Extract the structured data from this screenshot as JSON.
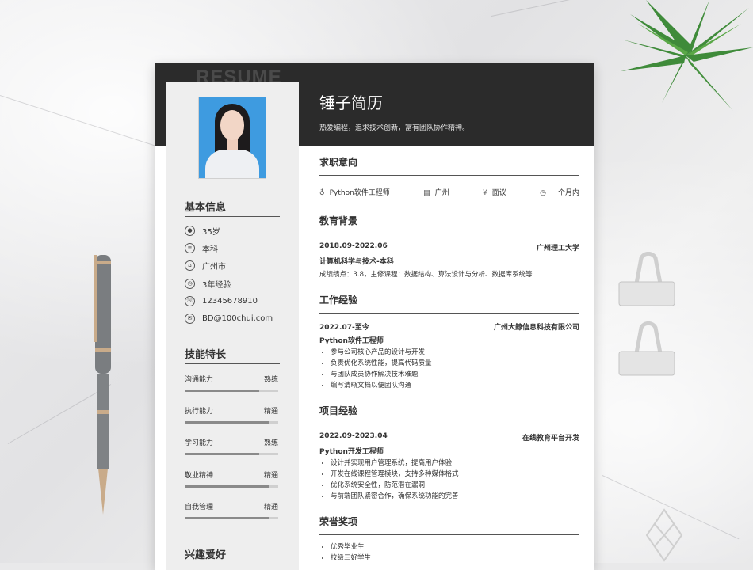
{
  "resume": {
    "watermark": "RESUME",
    "name": "锤子简历",
    "tagline": "热爱编程，追求技术创新，富有团队协作精神。",
    "basic_info": {
      "title": "基本信息",
      "items": [
        {
          "icon": "person-icon",
          "text": "35岁"
        },
        {
          "icon": "degree-icon",
          "text": "本科"
        },
        {
          "icon": "home-icon",
          "text": "广州市"
        },
        {
          "icon": "clock-icon",
          "text": "3年经验"
        },
        {
          "icon": "phone-icon",
          "text": "12345678910"
        },
        {
          "icon": "mail-icon",
          "text": "BD@100chui.com"
        }
      ]
    },
    "skills": {
      "title": "技能特长",
      "items": [
        {
          "name": "沟通能力",
          "level": "熟练",
          "fill": 0.8
        },
        {
          "name": "执行能力",
          "level": "精通",
          "fill": 0.9
        },
        {
          "name": "学习能力",
          "level": "熟练",
          "fill": 0.8
        },
        {
          "name": "敬业精神",
          "level": "精通",
          "fill": 0.9
        },
        {
          "name": "自我管理",
          "level": "精通",
          "fill": 0.9
        }
      ]
    },
    "hobbies": {
      "title": "兴趣爱好"
    },
    "job_intent": {
      "title": "求职意向",
      "position": "Python软件工程师",
      "city": "广州",
      "salary": "面议",
      "availability": "一个月内"
    },
    "education": {
      "title": "教育背景",
      "period": "2018.09-2022.06",
      "school": "广州理工大学",
      "major": "计算机科学与技术-本科",
      "detail": "成绩绩点：3.8，主修课程：数据结构、算法设计与分析、数据库系统等"
    },
    "work": {
      "title": "工作经验",
      "period": "2022.07-至今",
      "company": "广州大鲸信息科技有限公司",
      "role": "Python软件工程师",
      "bullets": [
        "参与公司核心产品的设计与开发",
        "负责优化系统性能，提高代码质量",
        "与团队成员协作解决技术难题",
        "编写清晰文档以便团队沟通"
      ]
    },
    "project": {
      "title": "项目经验",
      "period": "2022.09-2023.04",
      "name": "在线教育平台开发",
      "role": "Python开发工程师",
      "bullets": [
        "设计并实现用户管理系统，提高用户体验",
        "开发在线课程管理模块，支持多种媒体格式",
        "优化系统安全性，防范潜在漏洞",
        "与前端团队紧密合作，确保系统功能的完善"
      ]
    },
    "honors": {
      "title": "荣誉奖项",
      "bullets": [
        "优秀毕业生",
        "校级三好学生"
      ]
    }
  },
  "colors": {
    "header": "#2b2b2b",
    "sidebar": "#eeeeee",
    "photo_bg": "#3e9be0"
  }
}
